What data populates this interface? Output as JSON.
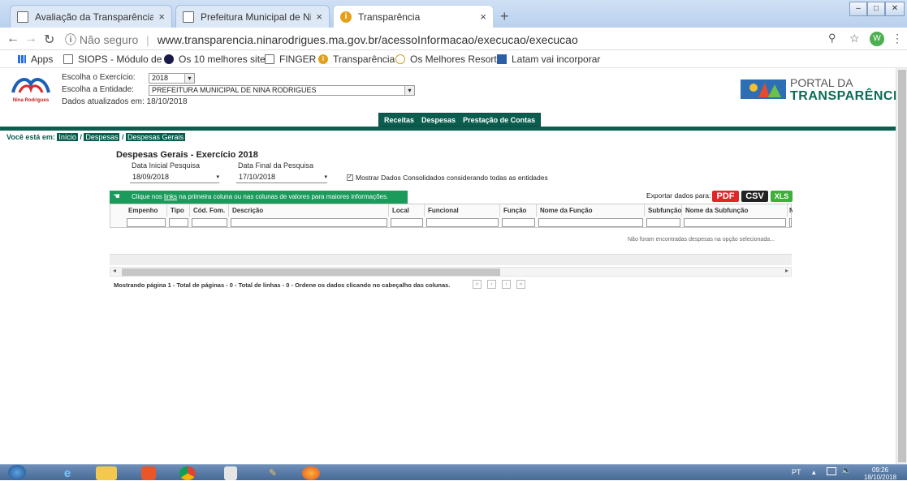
{
  "browser": {
    "tabs": [
      {
        "title": "Avaliação da Transparência dos /",
        "active": false
      },
      {
        "title": "Prefeitura Municipal de Nina Roc",
        "active": false
      },
      {
        "title": "Transparência",
        "active": true
      }
    ],
    "new_tab": "+",
    "url_prefix": "Não seguro",
    "url": "www.transparencia.ninarodrigues.ma.gov.br/acessoInformacao/execucao/execucao",
    "profile_initial": "W",
    "bookmarks": [
      "Apps",
      "SIOPS - Módulo de C",
      "Os 10 melhores sites",
      "FINGER",
      "Transparência",
      "Os Melhores Resorts",
      "Latam vai incorporar"
    ]
  },
  "header": {
    "logo_text": "Nina Rodrigues",
    "exercicio_label": "Escolha o Exercício:",
    "exercicio_value": "2018",
    "entidade_label": "Escolha a Entidade:",
    "entidade_value": "PREFEITURA MUNICIPAL DE NINA RODRIGUES",
    "updated": "Dados atualizados em: 18/10/2018",
    "portal_line1": "PORTAL DA",
    "portal_line2": "TRANSPARÊNCIA"
  },
  "menu": [
    "Receitas",
    "Despesas",
    "Prestação de Contas"
  ],
  "breadcrumb": {
    "prefix": "Você está em:",
    "items": [
      "Início",
      "Despesas",
      "Despesas Gerais"
    ]
  },
  "content": {
    "title": "Despesas Gerais - Exercício 2018",
    "start_label": "Data Inicial Pesquisa",
    "start_value": "18/09/2018",
    "end_label": "Data Final da Pesquisa",
    "end_value": "17/10/2018",
    "consolidated_label": "Mostrar Dados Consolidados considerando todas as entidades",
    "hint_pre": "Clique nos ",
    "hint_link": "links",
    "hint_post": " na primeira coluna ou nas colunas de valores para maiores informações.",
    "export_label": "Exportar dados para:",
    "export_pdf": "PDF",
    "export_csv": "CSV",
    "export_xls": "XLS",
    "columns": [
      "Empenho",
      "Tipo",
      "Cód. Fom.",
      "Descrição",
      "Local",
      "Funcional",
      "Função",
      "Nome da Função",
      "Subfunção",
      "Nome da Subfunção",
      "N"
    ],
    "empty_message": "Não foram encontradas despesas na opção selecionada...",
    "status": "Mostrando página 1 - Total de páginas - 0 - Total de linhas - 0 - Ordene os dados clicando no cabeçalho das colunas.",
    "pager": [
      "«",
      "‹",
      "›",
      "»"
    ]
  },
  "taskbar": {
    "lang": "PT",
    "time": "09:26",
    "date": "18/10/2018"
  }
}
